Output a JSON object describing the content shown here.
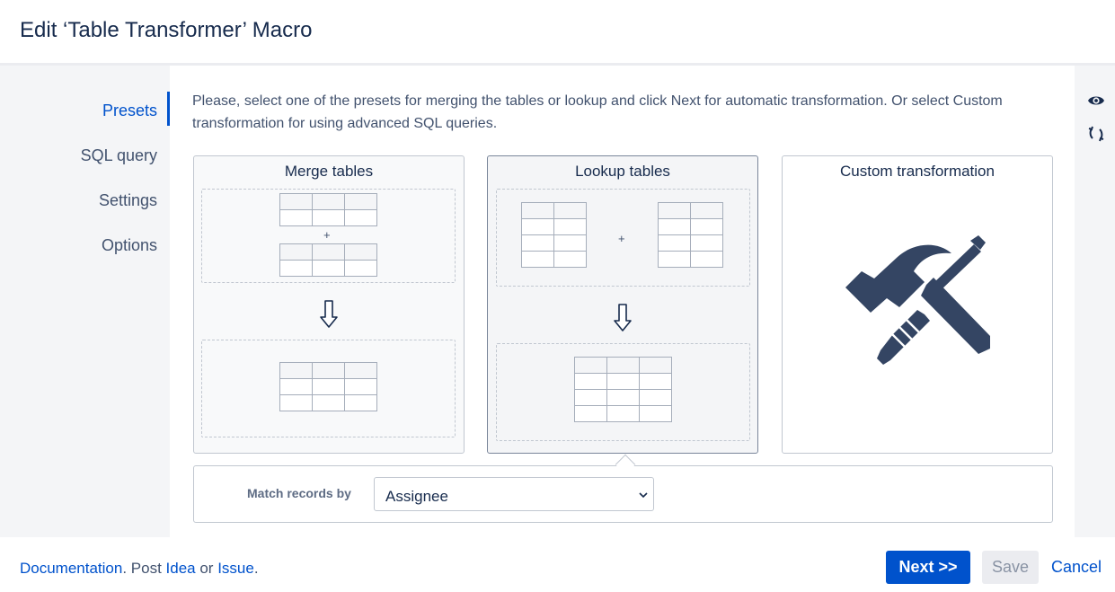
{
  "dialog": {
    "title": "Edit ‘Table Transformer’ Macro"
  },
  "nav": {
    "items": [
      {
        "label": "Presets",
        "active": true
      },
      {
        "label": "SQL query",
        "active": false
      },
      {
        "label": "Settings",
        "active": false
      },
      {
        "label": "Options",
        "active": false
      }
    ]
  },
  "rail": {
    "icons": [
      "eye-icon",
      "refresh-icon"
    ]
  },
  "intro": "Please, select one of the presets for merging the tables or lookup and click Next for automatic transformation. Or select Custom transformation for using advanced SQL queries.",
  "presets": [
    {
      "title": "Merge tables",
      "plus": "+"
    },
    {
      "title": "Lookup tables",
      "plus": "+",
      "selected": true
    },
    {
      "title": "Custom transformation",
      "icon": "hammer-screwdriver-icon"
    }
  ],
  "match": {
    "label": "Match records by",
    "value": "Assignee"
  },
  "footer": {
    "documentation": "Documentation",
    "post_text": ". Post ",
    "idea": "Idea",
    "or_text": " or ",
    "issue": "Issue",
    "end_text": ".",
    "next_label": "Next >>",
    "save_label": "Save",
    "cancel_label": "Cancel"
  },
  "colors": {
    "accent": "#0052cc",
    "icon": "#344563",
    "text": "#172b4d"
  }
}
